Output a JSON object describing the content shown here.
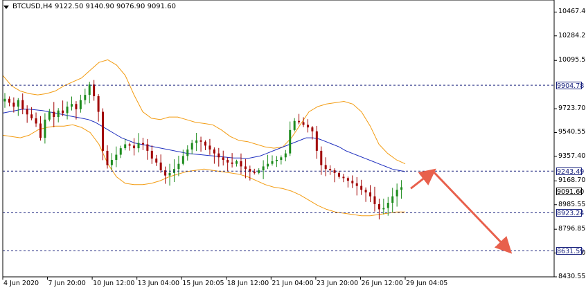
{
  "header": {
    "symbol": "BTCUSD,H4",
    "ohlc": "9122.50 9140.90 9076.90 9091.60"
  },
  "price_axis": {
    "labels": [
      "10467.40",
      "10284.25",
      "10095.55",
      "9723.70",
      "9540.55",
      "9357.40",
      "9168.70",
      "8985.55",
      "8796.85",
      "8613.70",
      "8430.55"
    ]
  },
  "date_axis": {
    "labels": [
      "4 Jun 2020",
      "7 Jun 20:00",
      "10 Jun 12:00",
      "13 Jun 04:00",
      "15 Jun 20:05",
      "18 Jun 12:00",
      "21 Jun 04:00",
      "23 Jun 20:00",
      "26 Jun 12:00",
      "29 Jun 04:05"
    ]
  },
  "current_price": {
    "value": "9091.60",
    "color": "#000000"
  },
  "levels": [
    {
      "value": "9904.78",
      "color": "#1a237e"
    },
    {
      "value": "9243.49",
      "color": "#1a237e"
    },
    {
      "value": "8923.24",
      "color": "#1a237e"
    },
    {
      "value": "8631.59",
      "color": "#1a237e"
    }
  ],
  "colors": {
    "bull_candle": "#1e8c1e",
    "bear_candle": "#a00000",
    "bollinger": "#f39c12",
    "moving_average": "#1f2fbf",
    "arrow": "#e8604c"
  },
  "chart_data": {
    "type": "candlestick",
    "title": "BTCUSD,H4",
    "ylim": [
      8430.55,
      10560
    ],
    "x": [
      "4 Jun 2020",
      "7 Jun 20:00",
      "10 Jun 12:00",
      "13 Jun 04:00",
      "15 Jun 20:05",
      "18 Jun 12:00",
      "21 Jun 04:00",
      "23 Jun 20:00",
      "26 Jun 12:00",
      "29 Jun 04:05"
    ],
    "close_path": [
      9800,
      9770,
      9740,
      9790,
      9720,
      9680,
      9650,
      9610,
      9500,
      9640,
      9700,
      9660,
      9710,
      9690,
      9740,
      9760,
      9720,
      9790,
      9830,
      9910,
      9820,
      9700,
      9400,
      9290,
      9330,
      9370,
      9420,
      9450,
      9440,
      9420,
      9460,
      9450,
      9400,
      9340,
      9310,
      9250,
      9210,
      9230,
      9260,
      9300,
      9360,
      9410,
      9460,
      9480,
      9470,
      9440,
      9410,
      9380,
      9350,
      9330,
      9310,
      9300,
      9320,
      9280,
      9260,
      9240,
      9230,
      9250,
      9280,
      9300,
      9320,
      9330,
      9350,
      9380,
      9560,
      9630,
      9620,
      9600,
      9580,
      9550,
      9400,
      9290,
      9260,
      9250,
      9230,
      9200,
      9190,
      9170,
      9150,
      9130,
      9100,
      9080,
      9050,
      8990,
      8950,
      8960,
      9000,
      9050,
      9100,
      9120
    ],
    "bollinger_upper": [
      9980,
      9900,
      9860,
      9840,
      9830,
      9840,
      9860,
      9900,
      9930,
      9960,
      10020,
      10080,
      10100,
      10060,
      9980,
      9830,
      9700,
      9650,
      9640,
      9660,
      9660,
      9640,
      9620,
      9610,
      9600,
      9560,
      9510,
      9480,
      9470,
      9450,
      9430,
      9420,
      9430,
      9500,
      9600,
      9700,
      9740,
      9760,
      9770,
      9780,
      9760,
      9700,
      9590,
      9450,
      9380,
      9330,
      9300
    ],
    "bollinger_lower": [
      9520,
      9510,
      9500,
      9520,
      9560,
      9580,
      9590,
      9590,
      9600,
      9580,
      9540,
      9450,
      9300,
      9200,
      9150,
      9140,
      9140,
      9150,
      9170,
      9200,
      9220,
      9240,
      9250,
      9260,
      9250,
      9240,
      9230,
      9220,
      9200,
      9170,
      9140,
      9120,
      9110,
      9090,
      9060,
      9020,
      8980,
      8950,
      8930,
      8920,
      8910,
      8900,
      8900,
      8910,
      8920,
      8930,
      8930
    ],
    "moving_average": [
      9690,
      9700,
      9710,
      9720,
      9720,
      9715,
      9710,
      9700,
      9690,
      9680,
      9670,
      9660,
      9650,
      9640,
      9620,
      9590,
      9560,
      9530,
      9500,
      9480,
      9460,
      9450,
      9440,
      9430,
      9420,
      9410,
      9400,
      9390,
      9380,
      9375,
      9370,
      9365,
      9360,
      9355,
      9350,
      9345,
      9345,
      9340,
      9350,
      9360,
      9380,
      9400,
      9420,
      9440,
      9460,
      9480,
      9500,
      9500,
      9490,
      9470,
      9450,
      9430,
      9400,
      9380,
      9360,
      9340,
      9320,
      9300,
      9280,
      9260,
      9250,
      9240
    ],
    "projection_arrows": [
      {
        "from_x": "29 Jun 04:05",
        "from": 9110,
        "to": 9243.49
      },
      {
        "from": 9243.49,
        "to": 8631.59
      }
    ]
  }
}
